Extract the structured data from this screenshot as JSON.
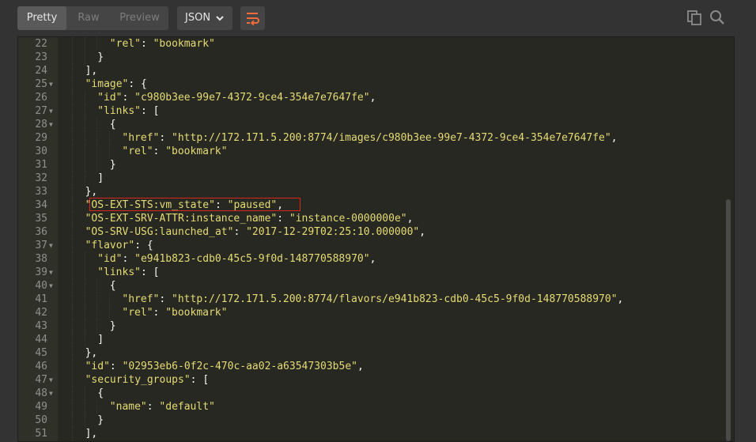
{
  "toolbar": {
    "view_tabs": [
      {
        "label": "Pretty",
        "active": true
      },
      {
        "label": "Raw",
        "active": false
      },
      {
        "label": "Preview",
        "active": false
      }
    ],
    "language": "JSON",
    "icons": {
      "wrap": "wrap-lines-icon",
      "copy": "copy-icon",
      "search": "search-icon"
    }
  },
  "colors": {
    "accent": "#f26b3a",
    "highlight_box": "#d9251c",
    "string": "#e6db74",
    "background": "#272822"
  },
  "code": {
    "lines": [
      {
        "n": "22",
        "fold": false,
        "indent": 4,
        "key": "\"rel\"",
        "after_key": ": ",
        "value": "\"bookmark\"",
        "tail": ""
      },
      {
        "n": "23",
        "fold": false,
        "indent": 3,
        "key": "",
        "after_key": "",
        "value": "",
        "tail": "}"
      },
      {
        "n": "24",
        "fold": false,
        "indent": 2,
        "key": "",
        "after_key": "",
        "value": "",
        "tail": "],"
      },
      {
        "n": "25",
        "fold": true,
        "indent": 2,
        "key": "\"image\"",
        "after_key": ": ",
        "value": "",
        "tail": "{"
      },
      {
        "n": "26",
        "fold": false,
        "indent": 3,
        "key": "\"id\"",
        "after_key": ": ",
        "value": "\"c980b3ee-99e7-4372-9ce4-354e7e7647fe\"",
        "tail": ","
      },
      {
        "n": "27",
        "fold": true,
        "indent": 3,
        "key": "\"links\"",
        "after_key": ": ",
        "value": "",
        "tail": "["
      },
      {
        "n": "28",
        "fold": true,
        "indent": 4,
        "key": "",
        "after_key": "",
        "value": "",
        "tail": "{"
      },
      {
        "n": "29",
        "fold": false,
        "indent": 5,
        "key": "\"href\"",
        "after_key": ": ",
        "value": "\"http://172.171.5.200:8774/images/c980b3ee-99e7-4372-9ce4-354e7e7647fe\"",
        "tail": ","
      },
      {
        "n": "30",
        "fold": false,
        "indent": 5,
        "key": "\"rel\"",
        "after_key": ": ",
        "value": "\"bookmark\"",
        "tail": ""
      },
      {
        "n": "31",
        "fold": false,
        "indent": 4,
        "key": "",
        "after_key": "",
        "value": "",
        "tail": "}"
      },
      {
        "n": "32",
        "fold": false,
        "indent": 3,
        "key": "",
        "after_key": "",
        "value": "",
        "tail": "]"
      },
      {
        "n": "33",
        "fold": false,
        "indent": 2,
        "key": "",
        "after_key": "",
        "value": "",
        "tail": "},"
      },
      {
        "n": "34",
        "fold": false,
        "indent": 2,
        "key": "\"OS-EXT-STS:vm_state\"",
        "after_key": ": ",
        "value": "\"paused\"",
        "tail": ","
      },
      {
        "n": "35",
        "fold": false,
        "indent": 2,
        "key": "\"OS-EXT-SRV-ATTR:instance_name\"",
        "after_key": ": ",
        "value": "\"instance-0000000e\"",
        "tail": ","
      },
      {
        "n": "36",
        "fold": false,
        "indent": 2,
        "key": "\"OS-SRV-USG:launched_at\"",
        "after_key": ": ",
        "value": "\"2017-12-29T02:25:10.000000\"",
        "tail": ","
      },
      {
        "n": "37",
        "fold": true,
        "indent": 2,
        "key": "\"flavor\"",
        "after_key": ": ",
        "value": "",
        "tail": "{"
      },
      {
        "n": "38",
        "fold": false,
        "indent": 3,
        "key": "\"id\"",
        "after_key": ": ",
        "value": "\"e941b823-cdb0-45c5-9f0d-148770588970\"",
        "tail": ","
      },
      {
        "n": "39",
        "fold": true,
        "indent": 3,
        "key": "\"links\"",
        "after_key": ": ",
        "value": "",
        "tail": "["
      },
      {
        "n": "40",
        "fold": true,
        "indent": 4,
        "key": "",
        "after_key": "",
        "value": "",
        "tail": "{"
      },
      {
        "n": "41",
        "fold": false,
        "indent": 5,
        "key": "\"href\"",
        "after_key": ": ",
        "value": "\"http://172.171.5.200:8774/flavors/e941b823-cdb0-45c5-9f0d-148770588970\"",
        "tail": ","
      },
      {
        "n": "42",
        "fold": false,
        "indent": 5,
        "key": "\"rel\"",
        "after_key": ": ",
        "value": "\"bookmark\"",
        "tail": ""
      },
      {
        "n": "43",
        "fold": false,
        "indent": 4,
        "key": "",
        "after_key": "",
        "value": "",
        "tail": "}"
      },
      {
        "n": "44",
        "fold": false,
        "indent": 3,
        "key": "",
        "after_key": "",
        "value": "",
        "tail": "]"
      },
      {
        "n": "45",
        "fold": false,
        "indent": 2,
        "key": "",
        "after_key": "",
        "value": "",
        "tail": "},"
      },
      {
        "n": "46",
        "fold": false,
        "indent": 2,
        "key": "\"id\"",
        "after_key": ": ",
        "value": "\"02953eb6-0f2c-470c-aa02-a63547303b5e\"",
        "tail": ","
      },
      {
        "n": "47",
        "fold": true,
        "indent": 2,
        "key": "\"security_groups\"",
        "after_key": ": ",
        "value": "",
        "tail": "["
      },
      {
        "n": "48",
        "fold": true,
        "indent": 3,
        "key": "",
        "after_key": "",
        "value": "",
        "tail": "{"
      },
      {
        "n": "49",
        "fold": false,
        "indent": 4,
        "key": "\"name\"",
        "after_key": ": ",
        "value": "\"default\"",
        "tail": ""
      },
      {
        "n": "50",
        "fold": false,
        "indent": 3,
        "key": "",
        "after_key": "",
        "value": "",
        "tail": "}"
      },
      {
        "n": "51",
        "fold": false,
        "indent": 2,
        "key": "",
        "after_key": "",
        "value": "",
        "tail": "],"
      }
    ]
  }
}
